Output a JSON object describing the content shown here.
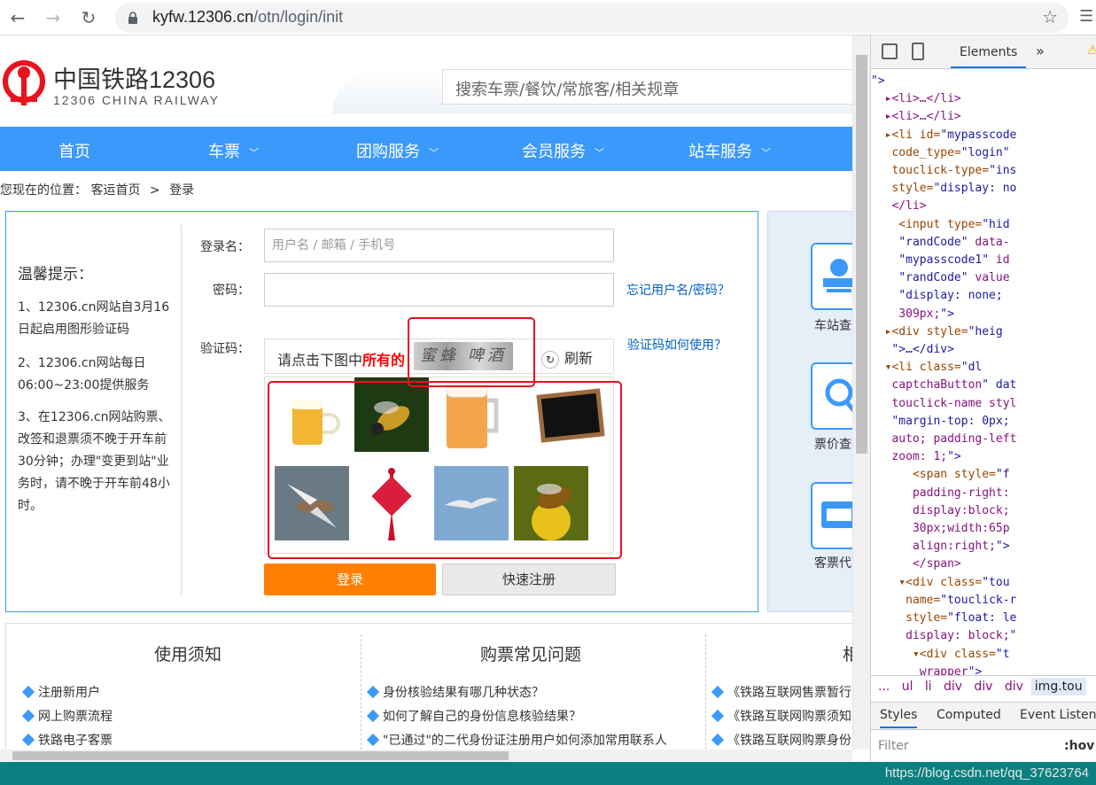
{
  "browser": {
    "url_domain": "kyfw.12306.cn",
    "url_path": "/otn/login/init"
  },
  "header": {
    "logo_cn": "中国铁路12306",
    "logo_en": "12306 CHINA RAILWAY",
    "search_placeholder": "搜索车票/餐饮/常旅客/相关规章"
  },
  "nav": {
    "items": [
      {
        "label": "首页"
      },
      {
        "label": "车票"
      },
      {
        "label": "团购服务"
      },
      {
        "label": "会员服务"
      },
      {
        "label": "站车服务"
      }
    ]
  },
  "breadcrumb": {
    "prefix": "您现在的位置：",
    "home": "客运首页",
    "sep": ">",
    "current": "登录"
  },
  "tips": {
    "title": "温馨提示：",
    "items": [
      "1、12306.cn网站自3月16日起启用图形验证码",
      "2、12306.cn网站每日06:00~23:00提供服务",
      "3、在12306.cn网站购票、改签和退票须不晚于开车前30分钟；办理\"变更到站\"业务时，请不晚于开车前48小时。"
    ]
  },
  "form": {
    "username_label": "登录名：",
    "username_placeholder": "用户名 / 邮箱 / 手机号",
    "password_label": "密码：",
    "forgot_link": "忘记用户名/密码？",
    "captcha_label": "验证码：",
    "captcha_help_link": "验证码如何使用？",
    "captcha_prompt": "请点击下图中",
    "captcha_prompt_bold": "所有的",
    "captcha_words": "蜜蜂 啤酒",
    "refresh_label": "刷新",
    "login_button": "登录",
    "register_button": "快速注册"
  },
  "captcha_tiles": [
    {
      "icon": "beer-mug-icon"
    },
    {
      "icon": "bee-icon"
    },
    {
      "icon": "beer-glass-icon"
    },
    {
      "icon": "chalkboard-icon"
    },
    {
      "icon": "bird-icon"
    },
    {
      "icon": "chinese-knot-icon"
    },
    {
      "icon": "seagull-icon"
    },
    {
      "icon": "bee-on-flower-icon"
    }
  ],
  "side": {
    "items": [
      {
        "label": "车站查",
        "icon": "station-icon"
      },
      {
        "label": "票价查",
        "icon": "magnifier-icon"
      },
      {
        "label": "客票代",
        "icon": "ticket-agent-icon"
      }
    ]
  },
  "bottom": {
    "columns": [
      {
        "title": "使用须知",
        "items": [
          "注册新用户",
          "网上购票流程",
          "铁路电子客票"
        ]
      },
      {
        "title": "购票常见问题",
        "items": [
          "身份核验结果有哪几种状态？",
          "如何了解自己的身份信息核验结果？",
          "\"已通过\"的二代身份证注册用户如何添加常用联系人"
        ]
      },
      {
        "title": "相",
        "items": [
          "《铁路互联网售票暂行",
          "《铁路互联网购票须知",
          "《铁路互联网购票身份"
        ]
      }
    ]
  },
  "devtools": {
    "tab_label": "Elements",
    "more": "»",
    "code_lines": [
      "\">",
      "  ▸<li>…</li>",
      "  ▸<li>…</li>",
      "  ▸<li id=\"mypasscode",
      "   code_type=\"login\"",
      "   touclick-type=\"ins",
      "   style=\"display: no",
      "   </li>",
      "    <input type=\"hid",
      "    \"randCode\" data-",
      "    \"mypasscode1\" id",
      "    \"randCode\" value",
      "    \"display: none; ",
      "    309px;\">",
      "  ▸<div style=\"heig",
      "   \">…</div>",
      "  ▾<li class=\"dl",
      "   captchaButton\" dat",
      "   touclick-name styl",
      "   \"margin-top: 0px; ",
      "   auto; padding-left",
      "   zoom: 1;\">",
      "      <span style=\"f",
      "      padding-right:",
      "      display:block;",
      "      30px;width:65p",
      "      align:right;\">",
      "      </span>",
      "    ▾<div class=\"tou",
      "     name=\"touclick-r",
      "     style=\"float: le",
      "     display: block;\"",
      "      ▾<div class=\"t",
      "       wrapper\">"
    ],
    "crumbs": [
      "...",
      "ul",
      "li",
      "div",
      "div",
      "div"
    ],
    "crumb_selected": "img.tou",
    "style_tabs": [
      "Styles",
      "Computed",
      "Event Listene"
    ],
    "filter_placeholder": "Filter",
    "hov": ":hov"
  },
  "watermark": "https://blog.csdn.net/qq_37623764",
  "colors": {
    "nav_blue": "#3b99fc",
    "login_orange": "#ff8000",
    "highlight_red": "#e8131d",
    "link_blue": "#0061c6"
  }
}
